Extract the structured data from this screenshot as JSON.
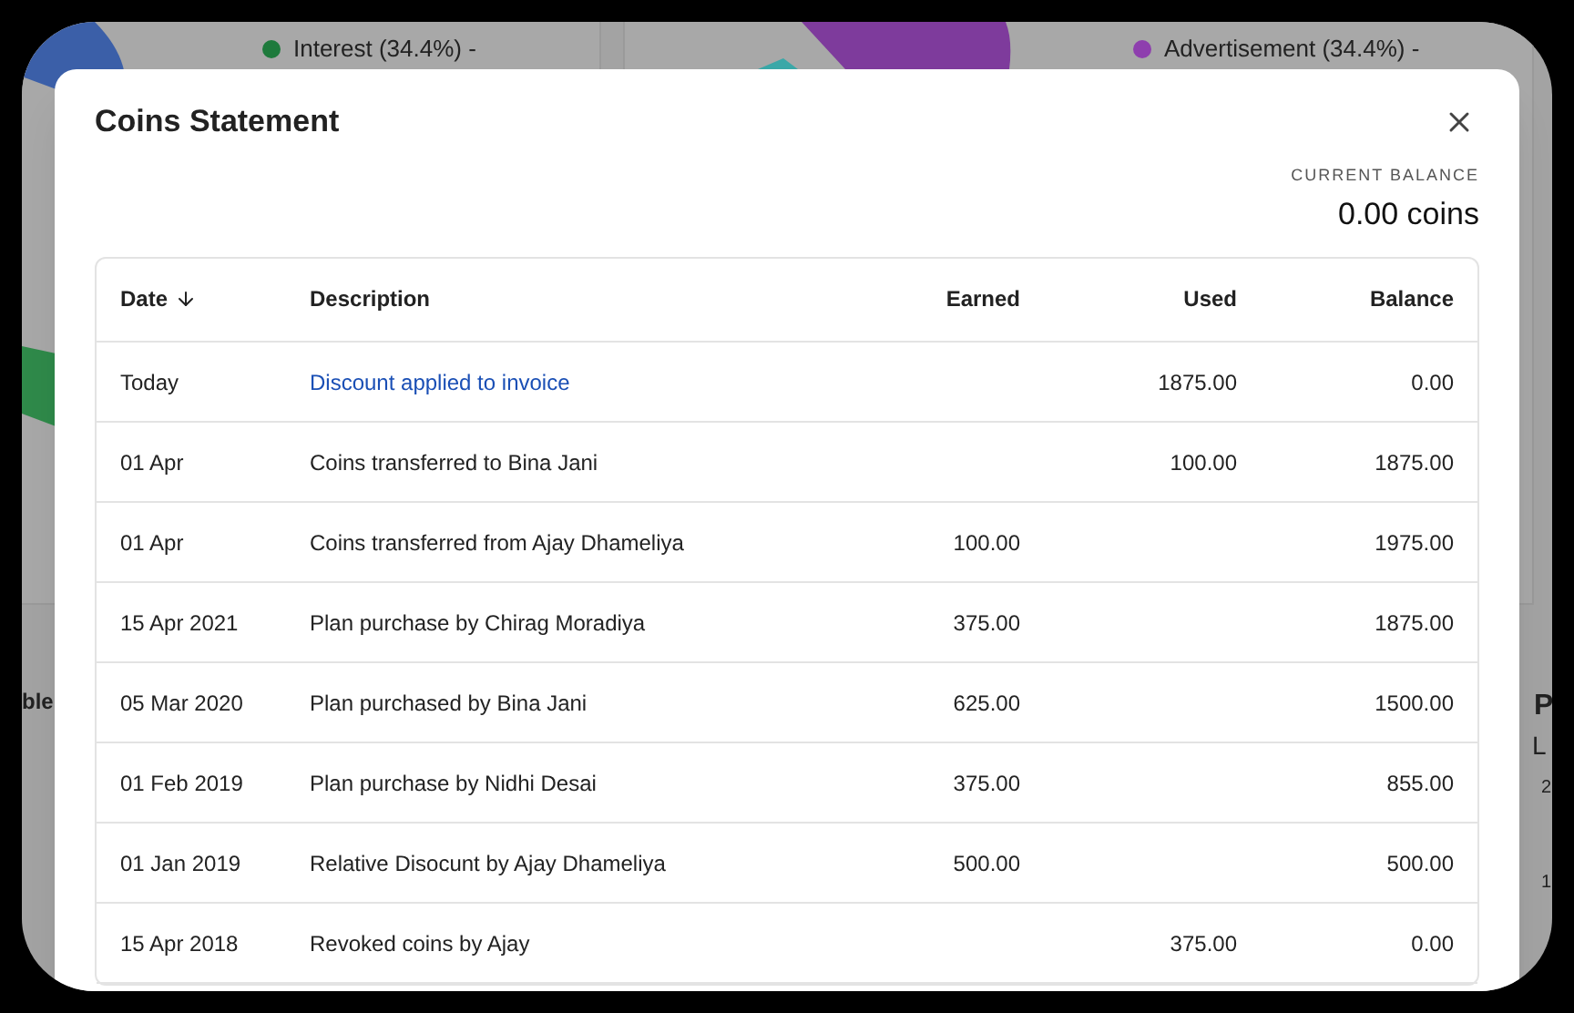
{
  "backdrop": {
    "legend": [
      {
        "label": "Interest (34.4%) -",
        "color": "#1e7a3c"
      },
      {
        "label": "Advertisement (34.4%) -",
        "color": "#8e3fae"
      }
    ],
    "left_fragment": "ble",
    "right_fragments": [
      "P",
      "L",
      "2",
      "1"
    ]
  },
  "dialog": {
    "title": "Coins Statement",
    "balance_label": "CURRENT BALANCE",
    "balance_value": "0.00 coins"
  },
  "table": {
    "columns": [
      {
        "label": "Date",
        "sorted": true
      },
      {
        "label": "Description",
        "sorted": false
      },
      {
        "label": "Earned",
        "sorted": false
      },
      {
        "label": "Used",
        "sorted": false
      },
      {
        "label": "Balance",
        "sorted": false
      }
    ],
    "rows": [
      {
        "date": "Today",
        "description": "Discount applied to invoice",
        "kind": "link",
        "earned": "",
        "used": "1875.00",
        "balance": "0.00"
      },
      {
        "date": "01 Apr",
        "description": "Coins transferred to Bina Jani",
        "kind": "text",
        "earned": "",
        "used": "100.00",
        "balance": "1875.00"
      },
      {
        "date": "01 Apr",
        "description": "Coins transferred from Ajay Dhameliya",
        "kind": "text",
        "earned": "100.00",
        "used": "",
        "balance": "1975.00"
      },
      {
        "date": "15 Apr 2021",
        "description": "Plan purchase by Chirag Moradiya",
        "kind": "text",
        "earned": "375.00",
        "used": "",
        "balance": "1875.00"
      },
      {
        "date": "05 Mar 2020",
        "description": "Plan purchased by Bina Jani",
        "kind": "text",
        "earned": "625.00",
        "used": "",
        "balance": "1500.00"
      },
      {
        "date": "01 Feb 2019",
        "description": "Plan purchase by Nidhi Desai",
        "kind": "text",
        "earned": "375.00",
        "used": "",
        "balance": "855.00"
      },
      {
        "date": "01 Jan 2019",
        "description": "Relative Disocunt by Ajay Dhameliya",
        "kind": "text",
        "earned": "500.00",
        "used": "",
        "balance": "500.00"
      },
      {
        "date": "15 Apr 2018",
        "description": "Revoked coins by Ajay",
        "kind": "text",
        "earned": "",
        "used": "375.00",
        "balance": "0.00"
      }
    ]
  }
}
